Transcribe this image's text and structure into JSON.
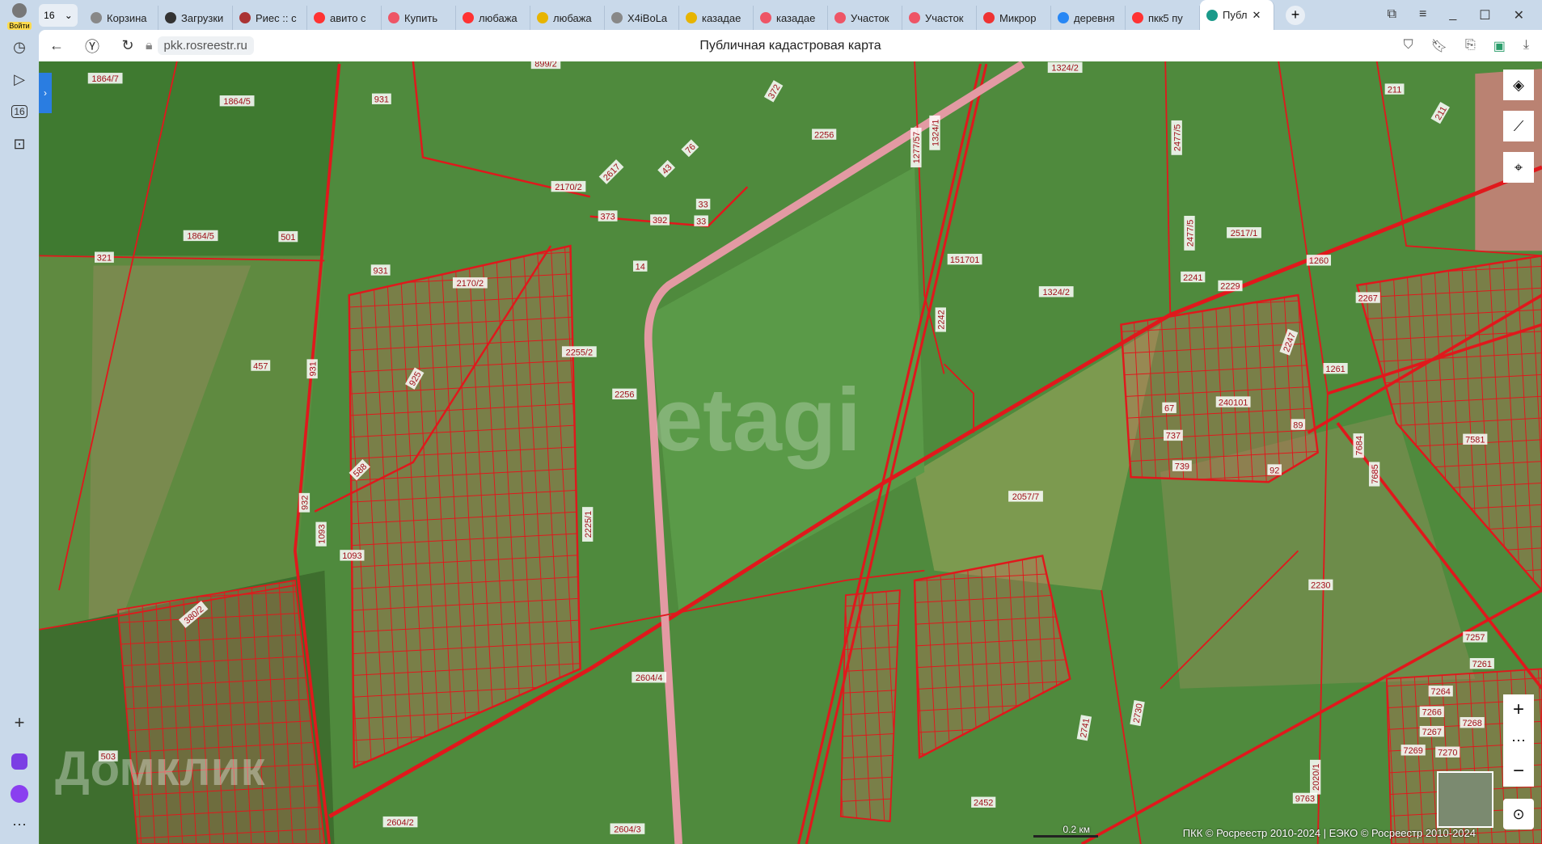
{
  "sidebar": {
    "login_label": "Войти",
    "tab_count": "16"
  },
  "tabs": [
    {
      "label": "Корзина",
      "icon": "page-icon",
      "color": "#888"
    },
    {
      "label": "Загрузки",
      "icon": "download-icon",
      "color": "#333"
    },
    {
      "label": "Риес :: с",
      "icon": "site-icon",
      "color": "#a33"
    },
    {
      "label": "авито с",
      "icon": "yandex-icon",
      "color": "#f33"
    },
    {
      "label": "Купить",
      "icon": "site-icon",
      "color": "#e56"
    },
    {
      "label": "любажа",
      "icon": "yandex-icon",
      "color": "#f33"
    },
    {
      "label": "любажа",
      "icon": "image-icon",
      "color": "#e7b400"
    },
    {
      "label": "X4iBoLa",
      "icon": "page-icon",
      "color": "#888"
    },
    {
      "label": "казадае",
      "icon": "image-icon",
      "color": "#e7b400"
    },
    {
      "label": "казадае",
      "icon": "site-icon",
      "color": "#e56"
    },
    {
      "label": "Участок",
      "icon": "site-icon",
      "color": "#e56"
    },
    {
      "label": "Участок",
      "icon": "site-icon",
      "color": "#e56"
    },
    {
      "label": "Микрор",
      "icon": "map-pin-icon",
      "color": "#e33"
    },
    {
      "label": "деревня",
      "icon": "vk-icon",
      "color": "#2787f5"
    },
    {
      "label": "пкк5 пу",
      "icon": "yandex-icon",
      "color": "#f33"
    },
    {
      "label": "Публ",
      "icon": "rosreestr-icon",
      "color": "#1a9a8a",
      "active": true
    }
  ],
  "address": {
    "url": "pkk.rosreestr.ru",
    "page_title": "Публичная кадастровая карта"
  },
  "map": {
    "watermark_top": "etagi",
    "watermark_bottom": "Домклик",
    "scale": "0.2 км",
    "attribution": "ПКК © Росреестр 2010-2024 | ЕЭКО © Росреестр 2010-2024",
    "parcel_labels": [
      "1864/7",
      "899/2",
      "931",
      "1864/5",
      "372",
      "1324/2",
      "211",
      "2256",
      "1277/57",
      "1324/1",
      "2477/5",
      "211",
      "2170/2",
      "2617",
      "43",
      "76",
      "33",
      "33",
      "373",
      "392",
      "1864/5",
      "501",
      "321",
      "931",
      "2170/2",
      "14",
      "151701",
      "1324/2",
      "2477/5",
      "2517/1",
      "1260",
      "2241",
      "2229",
      "2267",
      "2255/2",
      "457",
      "931",
      "925",
      "2256",
      "2242",
      "240101",
      "67",
      "737",
      "739",
      "89",
      "92",
      "1261",
      "2247",
      "7581",
      "7684",
      "7685",
      "588",
      "2057/7",
      "2225/1",
      "932",
      "1093",
      "1093",
      "380/2",
      "2230",
      "7257",
      "7261",
      "7264",
      "7266",
      "7267",
      "7268",
      "7269",
      "7270",
      "2604/4",
      "2741",
      "2730",
      "503",
      "9763",
      "2452",
      "2604/2",
      "2604/3",
      "2020/1"
    ]
  }
}
